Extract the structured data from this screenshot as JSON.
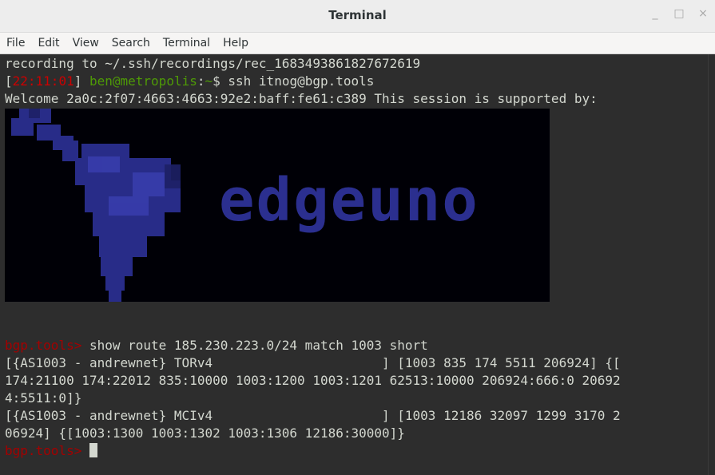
{
  "window": {
    "title": "Terminal",
    "buttons": [
      "_",
      "□",
      "×"
    ]
  },
  "menu": [
    "File",
    "Edit",
    "View",
    "Search",
    "Terminal",
    "Help"
  ],
  "terminal": {
    "line1": "recording to ~/.ssh/recordings/rec_1683493861827672619",
    "line2": {
      "bracket_open": "[",
      "time": "22:11:01",
      "bracket_close": "]",
      "user_host": "ben@metropolis",
      "sep": ":",
      "path": "~",
      "dollar": "$ ",
      "command": "ssh itnog@bgp.tools"
    },
    "line3": "Welcome 2a0c:2f07:4663:4663:92e2:baff:fe61:c389 This session is supported by:",
    "logo_text": "edgeuno",
    "prompt": "bgp.tools>",
    "command": " show route 185.230.223.0/24 match 1003 short",
    "output": [
      "[{AS1003 - andrewnet} TORv4                      ] [1003 835 174 5511 206924] {[",
      "174:21100 174:22012 835:10000 1003:1200 1003:1201 62513:10000 206924:666:0 20692",
      "4:5511:0]}",
      "[{AS1003 - andrewnet} MCIv4                      ] [1003 12186 32097 1299 3170 2",
      "06924] {[1003:1300 1003:1302 1003:1306 12186:30000]}"
    ],
    "prompt2": "bgp.tools>"
  },
  "colors": {
    "terminal_bg": "#2d2d2d",
    "text": "#d3d7cf",
    "time_red": "#cc0000",
    "user_green": "#4e9a06",
    "logo_blue": "#2b2f8f"
  }
}
